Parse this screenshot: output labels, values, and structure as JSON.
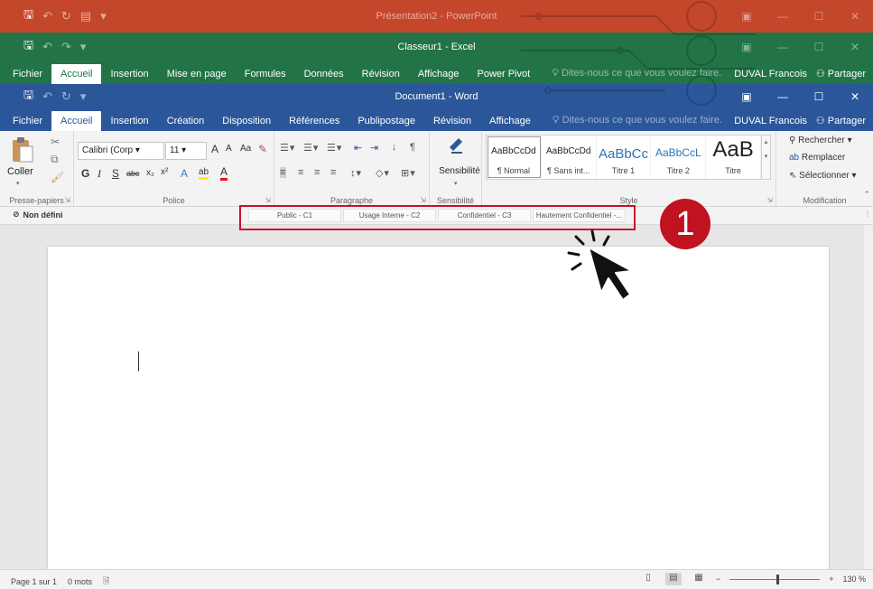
{
  "powerpoint": {
    "title": "Présentation2 - PowerPoint"
  },
  "excel": {
    "title": "Classeur1 - Excel",
    "tabs": [
      "Fichier",
      "Accueil",
      "Insertion",
      "Mise en page",
      "Formules",
      "Données",
      "Révision",
      "Affichage",
      "Power Pivot"
    ],
    "active_tab": "Accueil",
    "tell_me": "Dites-nous ce que vous voulez faire.",
    "user": "DUVAL Francois",
    "share": "Partager"
  },
  "word": {
    "title": "Document1 - Word",
    "tabs": [
      "Fichier",
      "Accueil",
      "Insertion",
      "Création",
      "Disposition",
      "Références",
      "Publipostage",
      "Révision",
      "Affichage"
    ],
    "active_tab": "Accueil",
    "tell_me": "Dites-nous ce que vous voulez faire.",
    "user": "DUVAL Francois",
    "share": "Partager"
  },
  "ribbon": {
    "clipboard": {
      "paste": "Coller",
      "label": "Presse-papiers"
    },
    "font": {
      "name": "Calibri (Corp",
      "size": "11",
      "label": "Police"
    },
    "paragraph": {
      "label": "Paragraphe"
    },
    "sensitivity": {
      "button": "Sensibilité",
      "label": "Sensibilité"
    },
    "styles": {
      "label": "Style",
      "items": [
        {
          "sample": "AaBbCcDd",
          "name": "¶ Normal",
          "color": "#222222",
          "size": "10px"
        },
        {
          "sample": "AaBbCcDd",
          "name": "¶ Sans int...",
          "color": "#222222",
          "size": "10px"
        },
        {
          "sample": "AaBbCc",
          "name": "Titre 1",
          "color": "#2e74b5",
          "size": "15px"
        },
        {
          "sample": "AaBbCcL",
          "name": "Titre 2",
          "color": "#2e74b5",
          "size": "12px"
        },
        {
          "sample": "AaB",
          "name": "Titre",
          "color": "#222222",
          "size": "24px"
        }
      ]
    },
    "editing": {
      "find": "Rechercher",
      "replace": "Remplacer",
      "select": "Sélectionner",
      "label": "Modification"
    }
  },
  "classification": {
    "current": "Non défini",
    "buttons": [
      "Public - C1",
      "Usage Interne - C2",
      "Confidentiel - C3",
      "Hautement Confidentiel -..."
    ]
  },
  "annotation": {
    "step": "1"
  },
  "status": {
    "page": "Page 1 sur 1",
    "words": "0 mots",
    "zoom": "130 %",
    "zoom_level_percent": 130
  },
  "colors": {
    "powerpoint": "#c4462b",
    "excel": "#227447",
    "word": "#2b579a",
    "highlight": "#c8102e"
  }
}
